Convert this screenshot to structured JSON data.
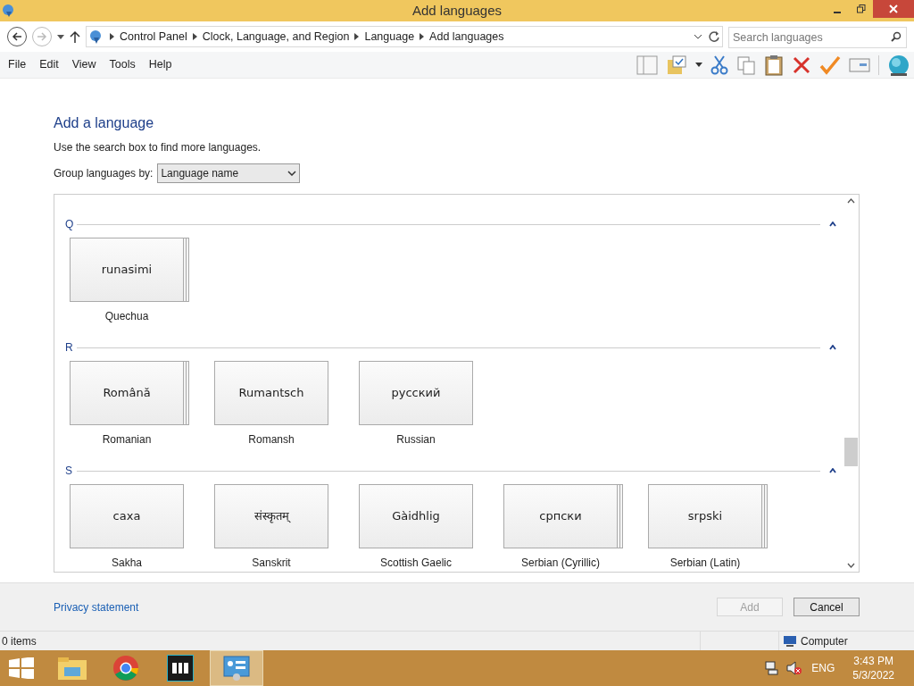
{
  "window": {
    "title": "Add languages"
  },
  "address_bar": {
    "crumbs": [
      "Control Panel",
      "Clock, Language, and Region",
      "Language",
      "Add languages"
    ]
  },
  "search": {
    "placeholder": "Search languages"
  },
  "menu": [
    "File",
    "Edit",
    "View",
    "Tools",
    "Help"
  ],
  "heading": "Add a language",
  "hint": "Use the search box to find more languages.",
  "group_by": {
    "label": "Group languages by:",
    "value": "Language name"
  },
  "groups": [
    {
      "letter": "Q",
      "languages": [
        {
          "native": "runasimi",
          "name": "Quechua",
          "stacked": true
        }
      ]
    },
    {
      "letter": "R",
      "languages": [
        {
          "native": "Română",
          "name": "Romanian",
          "stacked": true
        },
        {
          "native": "Rumantsch",
          "name": "Romansh",
          "stacked": false
        },
        {
          "native": "русский",
          "name": "Russian",
          "stacked": false
        }
      ]
    },
    {
      "letter": "S",
      "languages": [
        {
          "native": "саха",
          "name": "Sakha",
          "stacked": false
        },
        {
          "native": "संस्कृतम्",
          "name": "Sanskrit",
          "stacked": false
        },
        {
          "native": "Gàidhlig",
          "name": "Scottish Gaelic",
          "stacked": false
        },
        {
          "native": "српски",
          "name": "Serbian (Cyrillic)",
          "stacked": true
        },
        {
          "native": "srpski",
          "name": "Serbian (Latin)",
          "stacked": true
        }
      ]
    }
  ],
  "footer": {
    "link": "Privacy statement",
    "buttons": [
      {
        "label": "Add",
        "disabled": true
      },
      {
        "label": "Cancel",
        "disabled": false
      }
    ]
  },
  "status_bar": {
    "items": "0 items",
    "location": "Computer"
  },
  "taskbar": {
    "language": "ENG",
    "time": "3:43 PM",
    "date": "5/3/2022"
  }
}
